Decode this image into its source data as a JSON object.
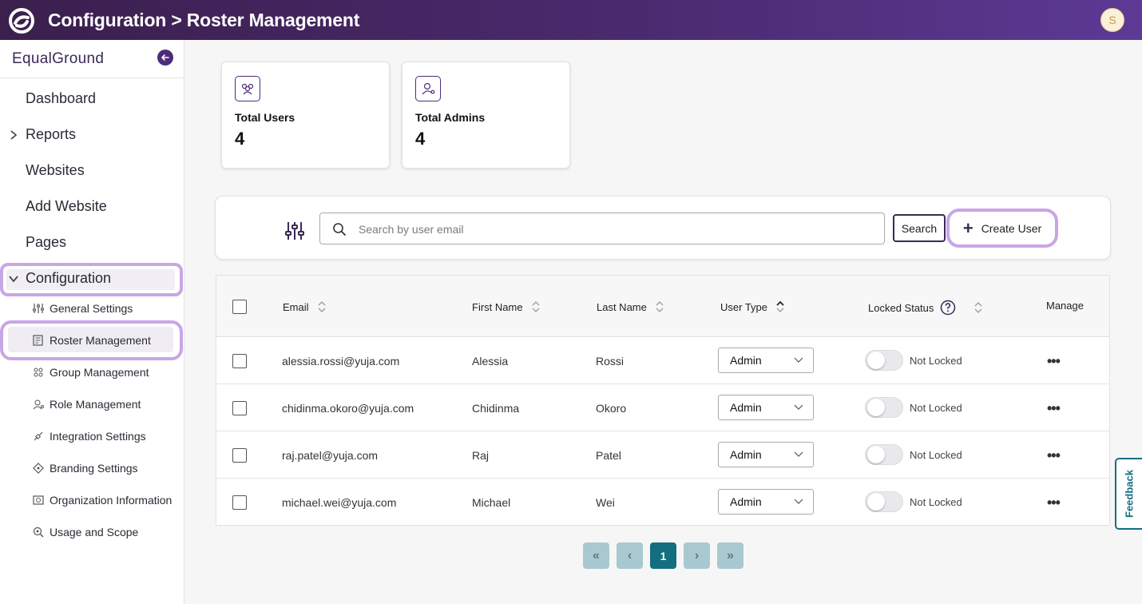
{
  "header": {
    "title": "Configuration > Roster Management",
    "avatar_initial": "S"
  },
  "sidebar": {
    "brand": "EqualGround",
    "nav": [
      {
        "label": "Dashboard"
      },
      {
        "label": "Reports"
      },
      {
        "label": "Websites"
      },
      {
        "label": "Add Website"
      },
      {
        "label": "Pages"
      },
      {
        "label": "Configuration"
      }
    ],
    "sub": [
      {
        "label": "General Settings",
        "icon": "sliders-icon"
      },
      {
        "label": "Roster Management",
        "icon": "roster-icon"
      },
      {
        "label": "Group Management",
        "icon": "group-icon"
      },
      {
        "label": "Role Management",
        "icon": "role-icon"
      },
      {
        "label": "Integration Settings",
        "icon": "integration-icon"
      },
      {
        "label": "Branding Settings",
        "icon": "branding-icon"
      },
      {
        "label": "Organization Information",
        "icon": "organization-icon"
      },
      {
        "label": "Usage and Scope",
        "icon": "usage-icon"
      }
    ]
  },
  "stats": {
    "total_users": {
      "label": "Total Users",
      "value": "4"
    },
    "total_admins": {
      "label": "Total Admins",
      "value": "4"
    }
  },
  "toolbar": {
    "search_placeholder": "Search by user email",
    "search_value": "",
    "search_label": "Search",
    "create_label": "Create User"
  },
  "table": {
    "columns": {
      "email": "Email",
      "first_name": "First Name",
      "last_name": "Last Name",
      "user_type": "User Type",
      "locked_status": "Locked Status",
      "manage": "Manage"
    },
    "rows": [
      {
        "email": "alessia.rossi@yuja.com",
        "first": "Alessia",
        "last": "Rossi",
        "type": "Admin",
        "locked": "Not Locked"
      },
      {
        "email": "chidinma.okoro@yuja.com",
        "first": "Chidinma",
        "last": "Okoro",
        "type": "Admin",
        "locked": "Not Locked"
      },
      {
        "email": "raj.patel@yuja.com",
        "first": "Raj",
        "last": "Patel",
        "type": "Admin",
        "locked": "Not Locked"
      },
      {
        "email": "michael.wei@yuja.com",
        "first": "Michael",
        "last": "Wei",
        "type": "Admin",
        "locked": "Not Locked"
      }
    ],
    "more_glyph": "•••"
  },
  "pagination": {
    "first": "«",
    "prev": "‹",
    "current": "1",
    "next": "›",
    "last": "»"
  },
  "feedback_label": "Feedback",
  "colors": {
    "header_start": "#3b1f4d",
    "header_end": "#5c3a95",
    "accent": "#4b2d7a",
    "highlight": "#c8a6e6",
    "pager_active": "#136f80",
    "pager_inactive": "#a8c9cf"
  }
}
